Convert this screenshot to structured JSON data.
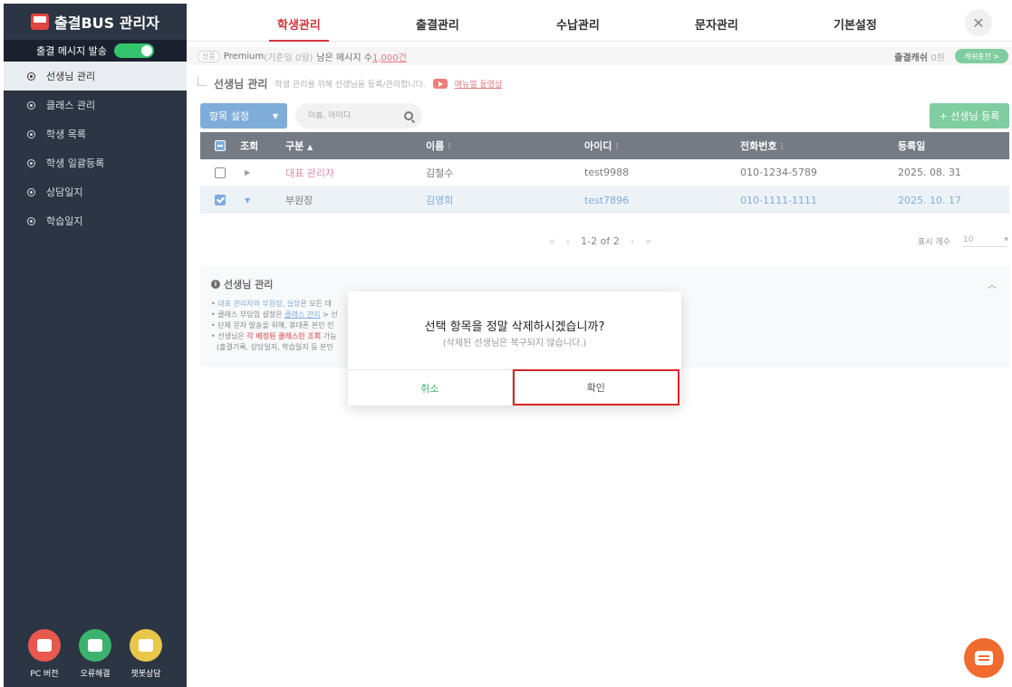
{
  "sidebar": {
    "brand": "출결BUS 관리자",
    "msg_toggle_label": "출결 메시지 발송",
    "items": [
      {
        "label": "선생님 관리"
      },
      {
        "label": "클래스 관리"
      },
      {
        "label": "학생 목록"
      },
      {
        "label": "학생 일괄등록"
      },
      {
        "label": "상담일지"
      },
      {
        "label": "학습일지"
      }
    ],
    "bottom": [
      {
        "label": "PC 버전"
      },
      {
        "label": "오류해결"
      },
      {
        "label": "챗봇상담"
      }
    ]
  },
  "nav": {
    "tabs": [
      "학생관리",
      "출결관리",
      "수납관리",
      "문자관리",
      "기본설정"
    ],
    "active": "학생관리"
  },
  "infobar": {
    "tag": "상품",
    "plan": "Premium",
    "plan_sub": "(기준일 0일)",
    "remain_label": "남은 메시지 수",
    "remain_value": "1,000건",
    "cash_label": "출결캐쉬",
    "cash_value": "0원",
    "charge_button": "캐쉬충전 >"
  },
  "page": {
    "title": "선생님 관리",
    "subtitle": "학생 관리를 위해 선생님을 등록/관리합니다.",
    "video_link": "매뉴얼 동영상"
  },
  "toolbar": {
    "settings_label": "항목 설정",
    "search_placeholder": "이름, 아이디",
    "add_button": "+ 선생님 등록"
  },
  "table": {
    "headers": {
      "view": "조회",
      "type": "구분",
      "name": "이름",
      "id": "아이디",
      "phone": "전화번호",
      "date": "등록일"
    },
    "rows": [
      {
        "type": "대표 관리자",
        "name": "김철수",
        "id": "test9988",
        "phone": "010-1234-5789",
        "date": "2025. 08. 31"
      },
      {
        "type": "부원장",
        "name": "김영희",
        "id": "test7896",
        "phone": "010-1111-1111",
        "date": "2025. 10. 17"
      }
    ]
  },
  "pager": {
    "range": "1-2 of 2",
    "per_page_label": "표시 개수",
    "per_page_value": "10"
  },
  "info": {
    "title": "선생님 관리",
    "line1_pre": "• ",
    "line1_highlight": "대표 관리자와 부원장, 실장",
    "line1_post": "은 모든 데",
    "line2_pre": "• 클래스 부담임 설정은 ",
    "line2_link": "클래스 관리",
    "line2_post": " > 선",
    "line3": "• 단체 문자 발송을 위해, 휴대폰 본인 인",
    "line4_pre": "• 선생님은 ",
    "line4_highlight": "각 배정된 클래스만 조회",
    "line4_post": " 가능",
    "line5": "(출결기록, 상담일지, 학습일지 등 본인"
  },
  "dialog": {
    "title": "선택 항목을 정말 삭제하시겠습니까?",
    "subtitle": "(삭제된 선생님은 복구되지 않습니다.)",
    "cancel": "취소",
    "confirm": "확인"
  }
}
